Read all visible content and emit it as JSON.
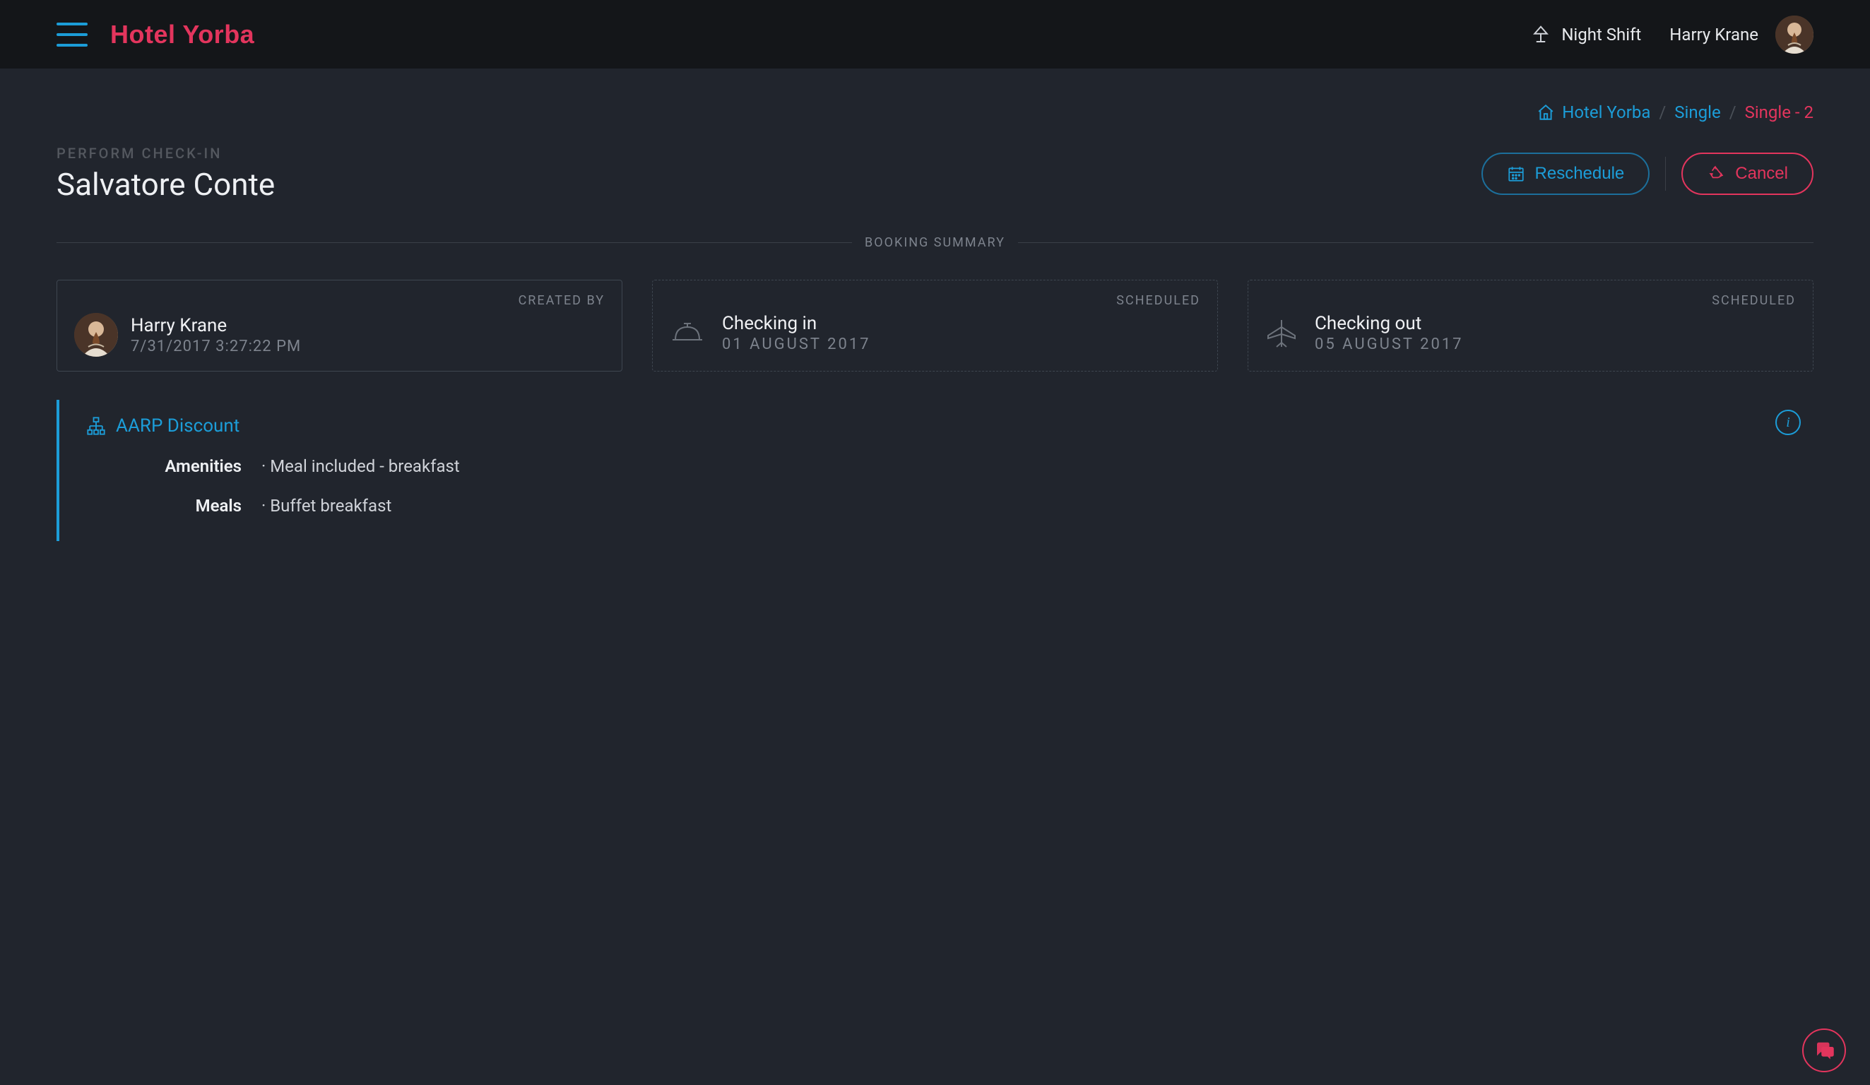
{
  "header": {
    "brand": "Hotel Yorba",
    "shift_label": "Night Shift",
    "user_name": "Harry Krane"
  },
  "breadcrumb": {
    "items": [
      {
        "label": "Hotel Yorba"
      },
      {
        "label": "Single"
      },
      {
        "label": "Single - 2"
      }
    ]
  },
  "title": {
    "kicker": "PERFORM CHECK-IN",
    "guest_name": "Salvatore Conte"
  },
  "actions": {
    "reschedule_label": "Reschedule",
    "cancel_label": "Cancel"
  },
  "section_label": "BOOKING SUMMARY",
  "cards": {
    "created": {
      "tag": "CREATED BY",
      "name": "Harry Krane",
      "timestamp": "7/31/2017 3:27:22 PM"
    },
    "checkin": {
      "tag": "SCHEDULED",
      "label": "Checking in",
      "date": "01 AUGUST 2017"
    },
    "checkout": {
      "tag": "SCHEDULED",
      "label": "Checking out",
      "date": "05 AUGUST 2017"
    }
  },
  "discount": {
    "title": "AARP Discount",
    "rows": [
      {
        "k": "Amenities",
        "v": "· Meal included - breakfast"
      },
      {
        "k": "Meals",
        "v": "· Buffet breakfast"
      }
    ]
  }
}
